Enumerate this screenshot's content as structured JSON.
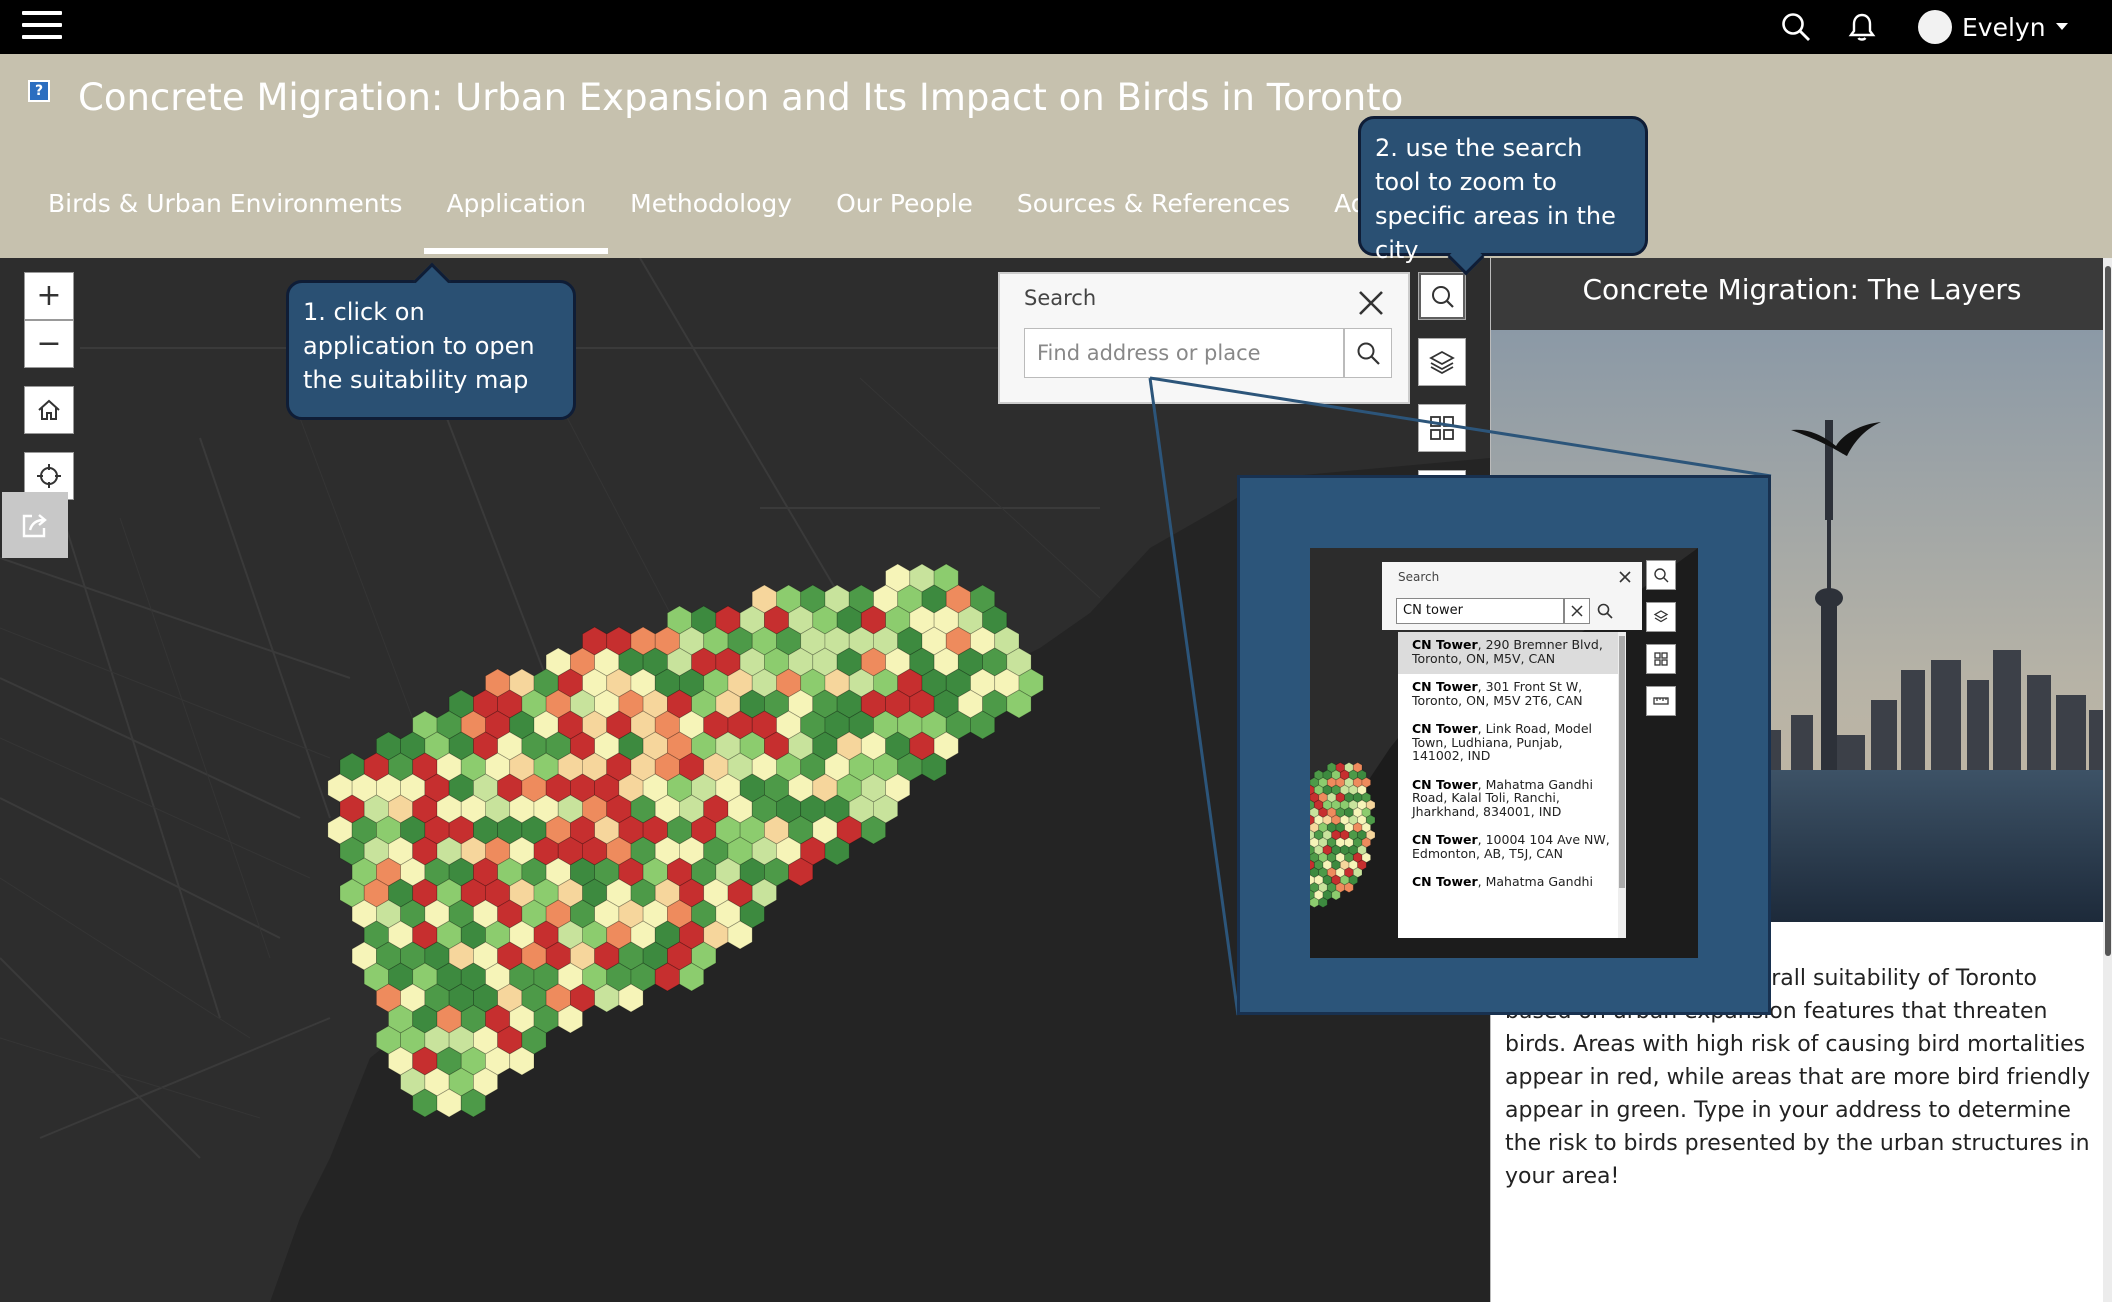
{
  "topbar": {
    "user_name": "Evelyn",
    "icons": [
      "hamburger-menu-icon",
      "search-icon",
      "bell-icon",
      "user-avatar",
      "caret-down-icon"
    ]
  },
  "header": {
    "help_badge": "?",
    "title": "Concrete Migration: Urban Expansion and Its Impact on Birds in Toronto",
    "tabs": [
      {
        "label": "Birds & Urban Environments"
      },
      {
        "label": "Application",
        "active": true
      },
      {
        "label": "Methodology"
      },
      {
        "label": "Our People"
      },
      {
        "label": "Sources & References"
      },
      {
        "label": "Additional Information"
      }
    ]
  },
  "map": {
    "zoom_in": "+",
    "zoom_out": "−",
    "controls": [
      "zoom-in",
      "zoom-out",
      "home-icon",
      "locate-icon",
      "share-icon"
    ],
    "search": {
      "title": "Search",
      "placeholder": "Find address or place"
    },
    "tools": [
      "search-icon",
      "layers-icon",
      "basemap-gallery-icon",
      "measure-icon"
    ],
    "hex_colors": [
      "#c62f2f",
      "#ee8b5d",
      "#f6d69c",
      "#f6f4b8",
      "#c8e39c",
      "#8ccc6e",
      "#4d9a48",
      "#3d8a3f"
    ]
  },
  "callouts": {
    "step1": "1. click on application to open the suitability map",
    "step2": "2. use the search tool to zoom to specific areas in the city"
  },
  "panel": {
    "title": "Concrete Migration: The Layers",
    "description": "This map shows the overall suitability of Toronto based on urban expansion features that threaten birds. Areas with high risk of causing bird mortalities appear in red, while areas that are more bird friendly appear in green. Type in your address to determine the risk to birds presented by the urban structures in your area!"
  },
  "inset": {
    "search_title": "Search",
    "query": "CN tower",
    "results": [
      {
        "name": "CN Tower",
        "address": ", 290 Bremner Blvd, Toronto, ON, M5V, CAN"
      },
      {
        "name": "CN Tower",
        "address": ", 301 Front St W, Toronto, ON, M5V 2T6, CAN"
      },
      {
        "name": "CN Tower",
        "address": ", Link Road, Model Town, Ludhiana, Punjab, 141002, IND"
      },
      {
        "name": "CN Tower",
        "address": ", Mahatma Gandhi Road, Kalal Toli, Ranchi, Jharkhand, 834001, IND"
      },
      {
        "name": "CN Tower",
        "address": ", 10004 104 Ave NW, Edmonton, AB, T5J, CAN"
      },
      {
        "name": "CN Tower",
        "address": ", Mahatma Gandhi"
      }
    ]
  }
}
